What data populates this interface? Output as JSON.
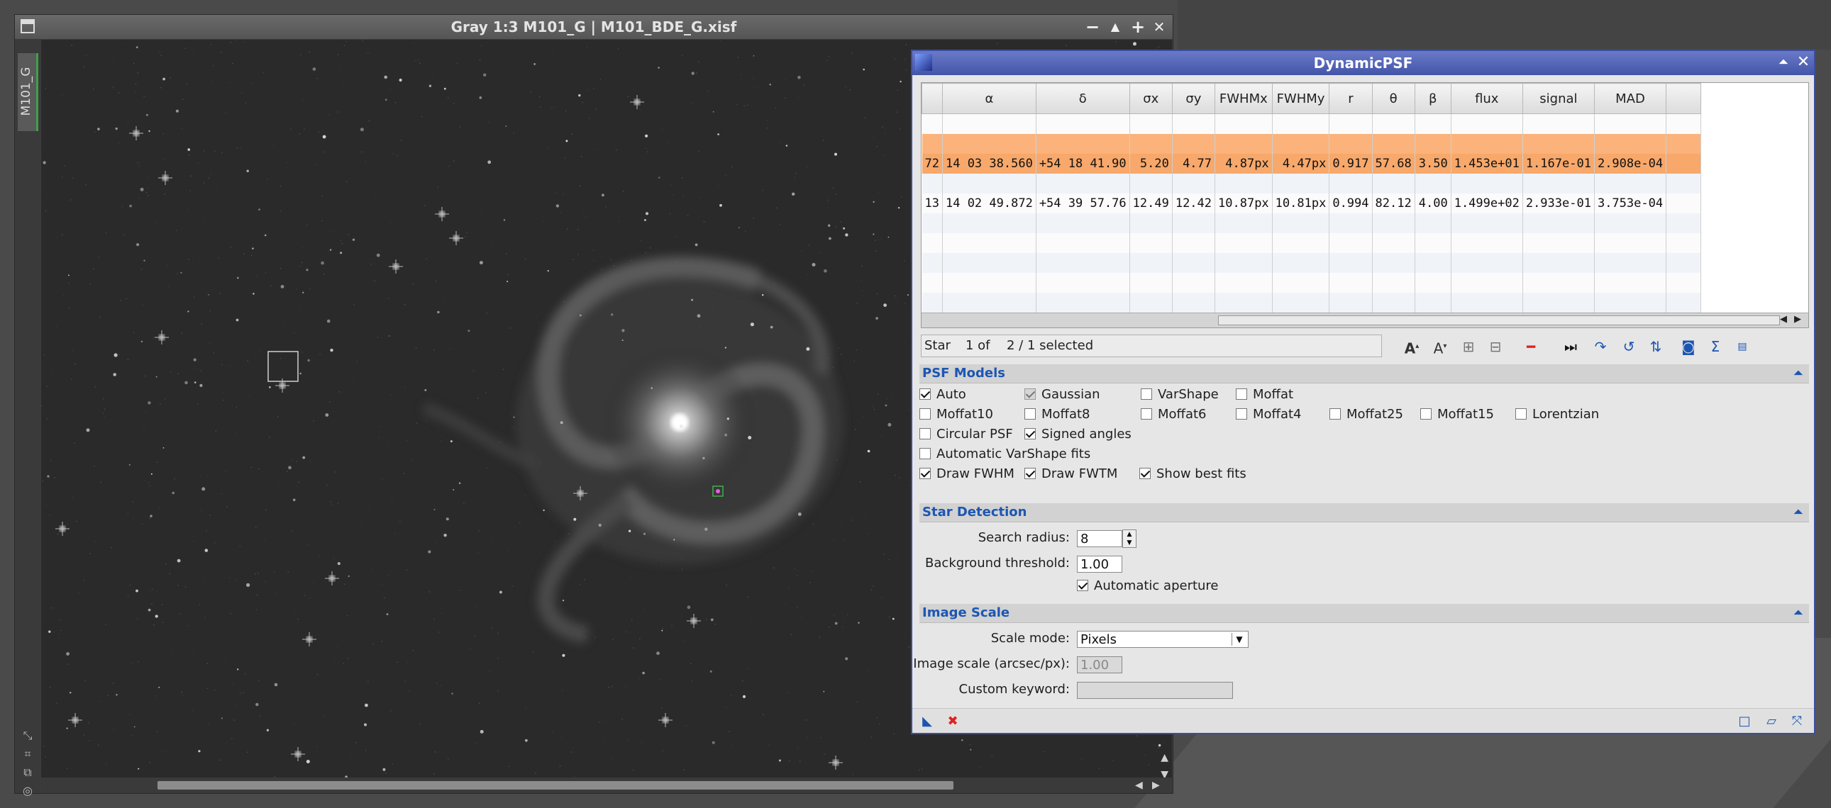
{
  "image_window": {
    "title": "Gray 1:3 M101_G | M101_BDE_G.xisf",
    "side_tab_label": "M101_G",
    "buttons": {
      "minimize": "−",
      "shade": "▲",
      "maximize": "+",
      "close": "✕"
    }
  },
  "psf_window": {
    "title": "DynamicPSF",
    "table": {
      "columns": [
        "",
        "α",
        "δ",
        "σx",
        "σy",
        "FWHMx",
        "FWHMy",
        "r",
        "θ",
        "β",
        "flux",
        "signal",
        "MAD"
      ],
      "rows": [
        {
          "id": "72",
          "alpha": "14 03 38.560",
          "delta": "+54 18 41.90",
          "sx": "5.20",
          "sy": "4.77",
          "fwhmx": "4.87px",
          "fwhmy": "4.47px",
          "r": "0.917",
          "theta": "57.68",
          "beta": "3.50",
          "flux": "1.453e+01",
          "signal": "1.167e-01",
          "mad": "2.908e-04",
          "selected": true
        },
        {
          "id": "13",
          "alpha": "14 02 49.872",
          "delta": "+54 39 57.76",
          "sx": "12.49",
          "sy": "12.42",
          "fwhmx": "10.87px",
          "fwhmy": "10.81px",
          "r": "0.994",
          "theta": "82.12",
          "beta": "4.00",
          "flux": "1.499e+02",
          "signal": "2.933e-01",
          "mad": "3.753e-04",
          "selected": false
        }
      ]
    },
    "status": {
      "star_label": "Star",
      "index": "1 of",
      "selection": "2 / 1 selected"
    },
    "psf_models": {
      "title": "PSF Models",
      "options": [
        {
          "label": "Auto",
          "checked": true,
          "enabled": true
        },
        {
          "label": "Gaussian",
          "checked": true,
          "enabled": false
        },
        {
          "label": "VarShape",
          "checked": false,
          "enabled": true
        },
        {
          "label": "Moffat",
          "checked": false,
          "enabled": true
        },
        {
          "label": "Moffat10",
          "checked": false,
          "enabled": true
        },
        {
          "label": "Moffat8",
          "checked": false,
          "enabled": true
        },
        {
          "label": "Moffat6",
          "checked": false,
          "enabled": true
        },
        {
          "label": "Moffat4",
          "checked": false,
          "enabled": true
        },
        {
          "label": "Moffat25",
          "checked": false,
          "enabled": true
        },
        {
          "label": "Moffat15",
          "checked": false,
          "enabled": true
        },
        {
          "label": "Lorentzian",
          "checked": false,
          "enabled": true
        },
        {
          "label": "Circular PSF",
          "checked": false,
          "enabled": true
        },
        {
          "label": "Signed angles",
          "checked": true,
          "enabled": true
        },
        {
          "label": "Automatic VarShape fits",
          "checked": false,
          "enabled": true
        },
        {
          "label": "Draw FWHM",
          "checked": true,
          "enabled": true
        },
        {
          "label": "Draw FWTM",
          "checked": true,
          "enabled": true
        },
        {
          "label": "Show best fits",
          "checked": true,
          "enabled": true
        }
      ]
    },
    "star_detection": {
      "title": "Star Detection",
      "search_radius_label": "Search radius:",
      "search_radius": "8",
      "background_threshold_label": "Background threshold:",
      "background_threshold": "1.00",
      "automatic_aperture_label": "Automatic aperture",
      "automatic_aperture": true
    },
    "image_scale": {
      "title": "Image Scale",
      "scale_mode_label": "Scale mode:",
      "scale_mode": "Pixels",
      "image_scale_label": "Image scale (arcsec/px):",
      "image_scale": "1.00",
      "custom_keyword_label": "Custom keyword:",
      "custom_keyword": ""
    },
    "collapse_glyph": "⏶"
  },
  "colors": {
    "accent": "#1c56b3",
    "selection": "#f7a86a",
    "title_blue": "#4355a8"
  },
  "icons": [
    "zoom-in-icon",
    "zoom-out-icon",
    "expand-icon",
    "collapse-icon",
    "delete-icon",
    "next-icon",
    "redo-icon",
    "reset-icon",
    "sort-icon",
    "camera-icon",
    "sum-icon",
    "csv-icon"
  ]
}
